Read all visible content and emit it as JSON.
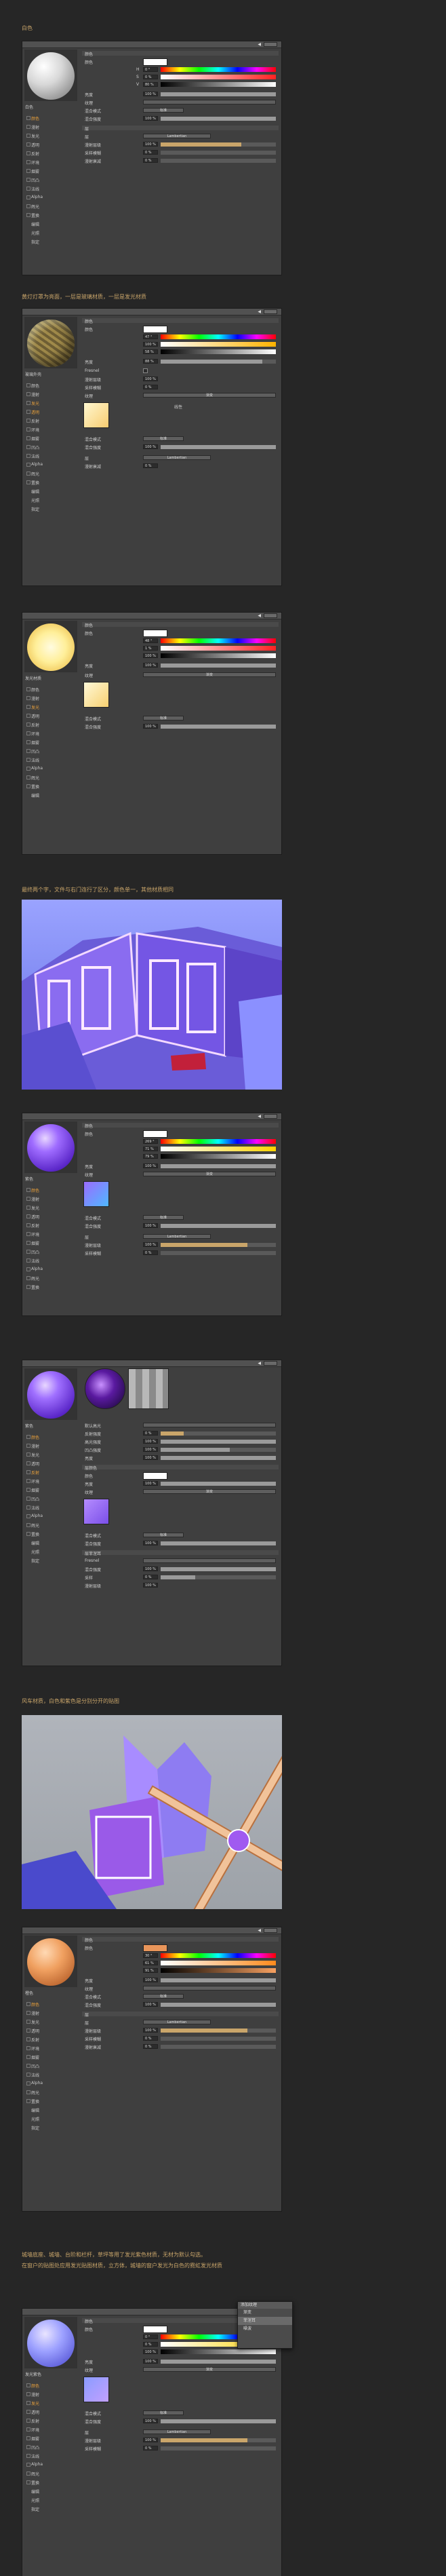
{
  "captions": {
    "c1": "白色",
    "c2": "黄灯灯罩为亮面，一层是玻璃材质，一层是发光材质",
    "c3": "黄色灯",
    "c4": "最终两个字，文件与右门连行了区分，颜色单一，其他材质相同",
    "c5": "风车材质，白色和紫色是分别分开的贴图",
    "c6": "城墙底座、城墙、台阶和栏杆，草坪等用了发光紫色材质，无材为默认勾选。",
    "c7": "在窗户的贴图处应用发光贴图材质，立方体，城墙的窗户发光为白色的霓虹发光材质"
  },
  "panel_common": {
    "tab_base": "基本",
    "color_label": "颜色",
    "color_sub": "颜色",
    "brightness": "亮度",
    "texture": "纹理",
    "mix_mode": "混合模式",
    "mix_strength": "混合强度",
    "normal": "标准",
    "pct100": "100 %",
    "pct0": "0 %",
    "h": "H",
    "s": "S",
    "v": "V",
    "diffuse_label": "漫射衰减",
    "diffuse_level": "漫射层级",
    "sample_blur": "采样模糊",
    "layer": "层",
    "layer_value": "Lambertian",
    "fresnel": "Fresnel",
    "gradient": "渐变",
    "linear": "线性"
  },
  "sidebar": {
    "items": [
      {
        "label": "颜色",
        "on": true
      },
      {
        "label": "漫射",
        "on": false
      },
      {
        "label": "发光",
        "on": false
      },
      {
        "label": "透明",
        "on": false
      },
      {
        "label": "反射",
        "on": false
      },
      {
        "label": "环境",
        "on": false
      },
      {
        "label": "烟雾",
        "on": false
      },
      {
        "label": "凹凸",
        "on": false
      },
      {
        "label": "法线",
        "on": false
      },
      {
        "label": "Alpha",
        "on": false
      },
      {
        "label": "辉光",
        "on": false
      },
      {
        "label": "置换",
        "on": false
      },
      {
        "label": "编辑",
        "on": false
      },
      {
        "label": "光照",
        "on": false
      },
      {
        "label": "指定",
        "on": false
      }
    ]
  },
  "materials": [
    {
      "name": "白色",
      "color": "#ffffff"
    },
    {
      "name": "玻璃外壳",
      "color": "#ffffff"
    },
    {
      "name": "发光材质",
      "color": "#ffffff"
    },
    {
      "name": "紫色",
      "color": "#ffffff"
    },
    {
      "name": "紫色",
      "color": "#ffffff"
    },
    {
      "name": "橙色",
      "color": "#e8955a"
    },
    {
      "name": "发光紫色",
      "color": "#ffffff"
    }
  ],
  "values": {
    "h1": "0 °",
    "s1": "0 %",
    "v1": "80 %",
    "b1": "100 %",
    "h2": "47 °",
    "s2": "100 %",
    "v2": "58 %",
    "b2": "88 %",
    "h3": "48 °",
    "s3": "1 %",
    "v3": "100 %",
    "b3": "100 %",
    "h4": "269 °",
    "s4": "71 %",
    "v4": "79 %",
    "b4": "100 %",
    "h6": "30 °",
    "s6": "61 %",
    "v6": "91 %",
    "b6": "100 %",
    "h7": "0 °",
    "s7": "0 %",
    "v7": "100 %",
    "b7": "100 %"
  },
  "panel5": {
    "spec_label": "亮度",
    "layer_label": "层",
    "default_specular": "默认高光",
    "reflect": "反射强度",
    "specular": "高光强度",
    "bump": "凹凸强度",
    "layer_color": "层颜色",
    "fresnel_label": "层菲涅耳",
    "sample": "采样"
  },
  "dropdown_menu": {
    "title": "添加纹理",
    "items": [
      "渐变",
      "菲涅耳",
      "噪波"
    ]
  },
  "colors": {
    "purple": "#7b5cff",
    "purple_light": "#b38bff",
    "orange": "#e8955a",
    "yellow_glow": "#fff3a0",
    "accent": "#e8a03c"
  }
}
